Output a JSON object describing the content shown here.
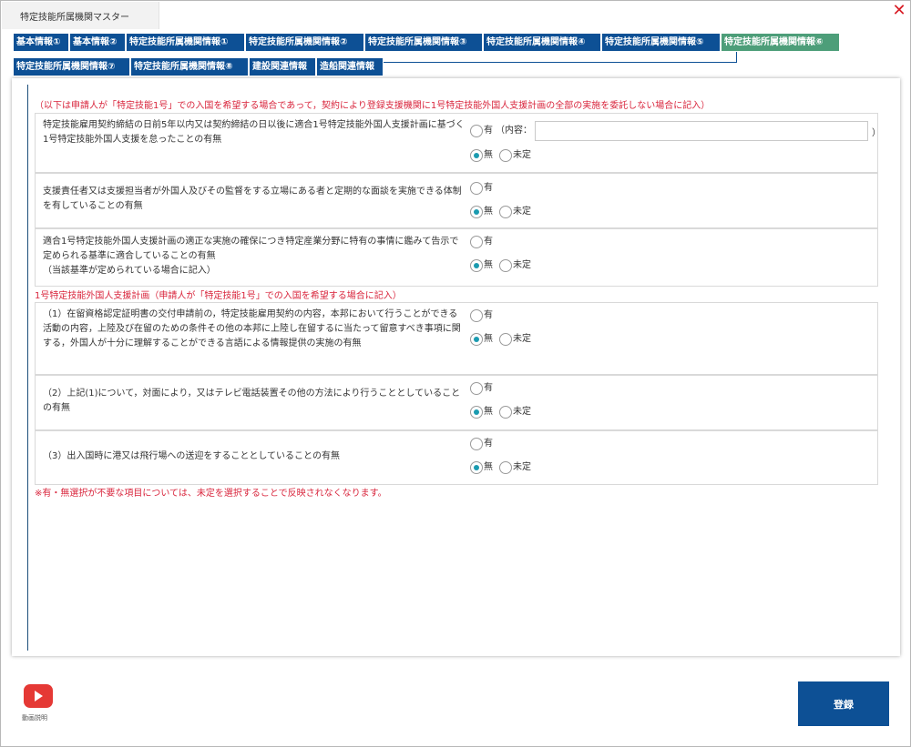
{
  "window": {
    "title": "特定技能所属機関マスター",
    "close_label": "✕"
  },
  "tabs": [
    {
      "label": "基本情報①",
      "active": false
    },
    {
      "label": "基本情報②",
      "active": false
    },
    {
      "label": "特定技能所属機関情報①",
      "active": false
    },
    {
      "label": "特定技能所属機関情報②",
      "active": false
    },
    {
      "label": "特定技能所属機関情報③",
      "active": false
    },
    {
      "label": "特定技能所属機関情報④",
      "active": false
    },
    {
      "label": "特定技能所属機関情報⑤",
      "active": false
    },
    {
      "label": "特定技能所属機関情報⑥",
      "active": true
    },
    {
      "label": "特定技能所属機関情報⑦",
      "active": false
    },
    {
      "label": "特定技能所属機関情報⑧",
      "active": false
    },
    {
      "label": "建設関連情報",
      "active": false
    },
    {
      "label": "造船関連情報",
      "active": false
    }
  ],
  "notes": {
    "top": "（以下は申請人が「特定技能1号」での入国を希望する場合であって，契約により登録支援機関に1号特定技能外国人支援計画の全部の実施を委託しない場合に記入）",
    "section2": "1号特定技能外国人支援計画（申請人が「特定技能1号」での入国を希望する場合に記入）",
    "footer": "※有・無選択が不要な項目については、未定を選択することで反映されなくなります。"
  },
  "options": {
    "yes": "有",
    "no": "無",
    "undecided": "未定",
    "content_prefix": "（内容：",
    "content_suffix": "）"
  },
  "questions": [
    {
      "text": "特定技能雇用契約締結の日前5年以内又は契約締結の日以後に適合1号特定技能外国人支援計画に基づく1号特定技能外国人支援を怠ったことの有無",
      "selected": "無",
      "content_value": ""
    },
    {
      "text": "支援責任者又は支援担当者が外国人及びその監督をする立場にある者と定期的な面談を実施できる体制を有していることの有無",
      "selected": "無"
    },
    {
      "text": "適合1号特定技能外国人支援計画の適正な実施の確保につき特定産業分野に特有の事情に鑑みて告示で定められる基準に適合していることの有無",
      "subtext": "（当該基準が定められている場合に記入）",
      "selected": "無"
    },
    {
      "text": "（1）在留資格認定証明書の交付申請前の，特定技能雇用契約の内容，本邦において行うことができる活動の内容，上陸及び在留のための条件その他の本邦に上陸し在留するに当たって留意すべき事項に関する，外国人が十分に理解することができる言語による情報提供の実施の有無",
      "selected": "無"
    },
    {
      "text": "（2）上記(1)について，対面により，又はテレビ電話装置その他の方法により行うこととしていることの有無",
      "selected": "無"
    },
    {
      "text": "（3）出入国時に港又は飛行場への送迎をすることとしていることの有無",
      "selected": "無"
    }
  ],
  "footer": {
    "video_label": "動画説明",
    "submit_label": "登録"
  }
}
